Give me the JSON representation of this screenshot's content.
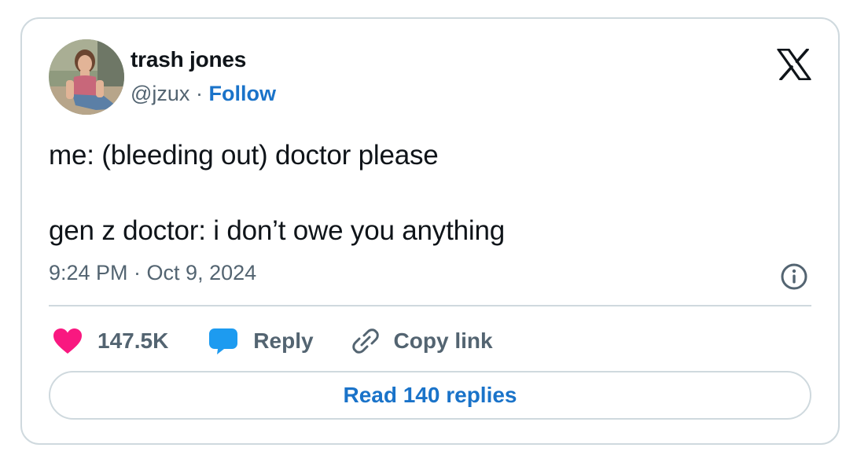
{
  "author": {
    "name": "trash jones",
    "handle": "@jzux",
    "separator": "·",
    "follow_label": "Follow"
  },
  "tweet": {
    "lines": [
      "me: (bleeding out) doctor please",
      "",
      "gen z doctor: i don’t owe you anything"
    ],
    "timestamp": "9:24 PM · Oct 9, 2024"
  },
  "actions": {
    "like_count": "147.5K",
    "reply_label": "Reply",
    "copy_link_label": "Copy link"
  },
  "read_replies_label": "Read 140 replies",
  "icons": {
    "brand": "x-logo-icon",
    "info": "info-icon",
    "like": "heart-icon",
    "reply": "speech-bubble-icon",
    "copy": "link-icon"
  },
  "colors": {
    "accent": "#1a73c9",
    "like": "#f91880",
    "reply": "#1d9bf0",
    "muted": "#536471",
    "border": "#cfd9de"
  }
}
